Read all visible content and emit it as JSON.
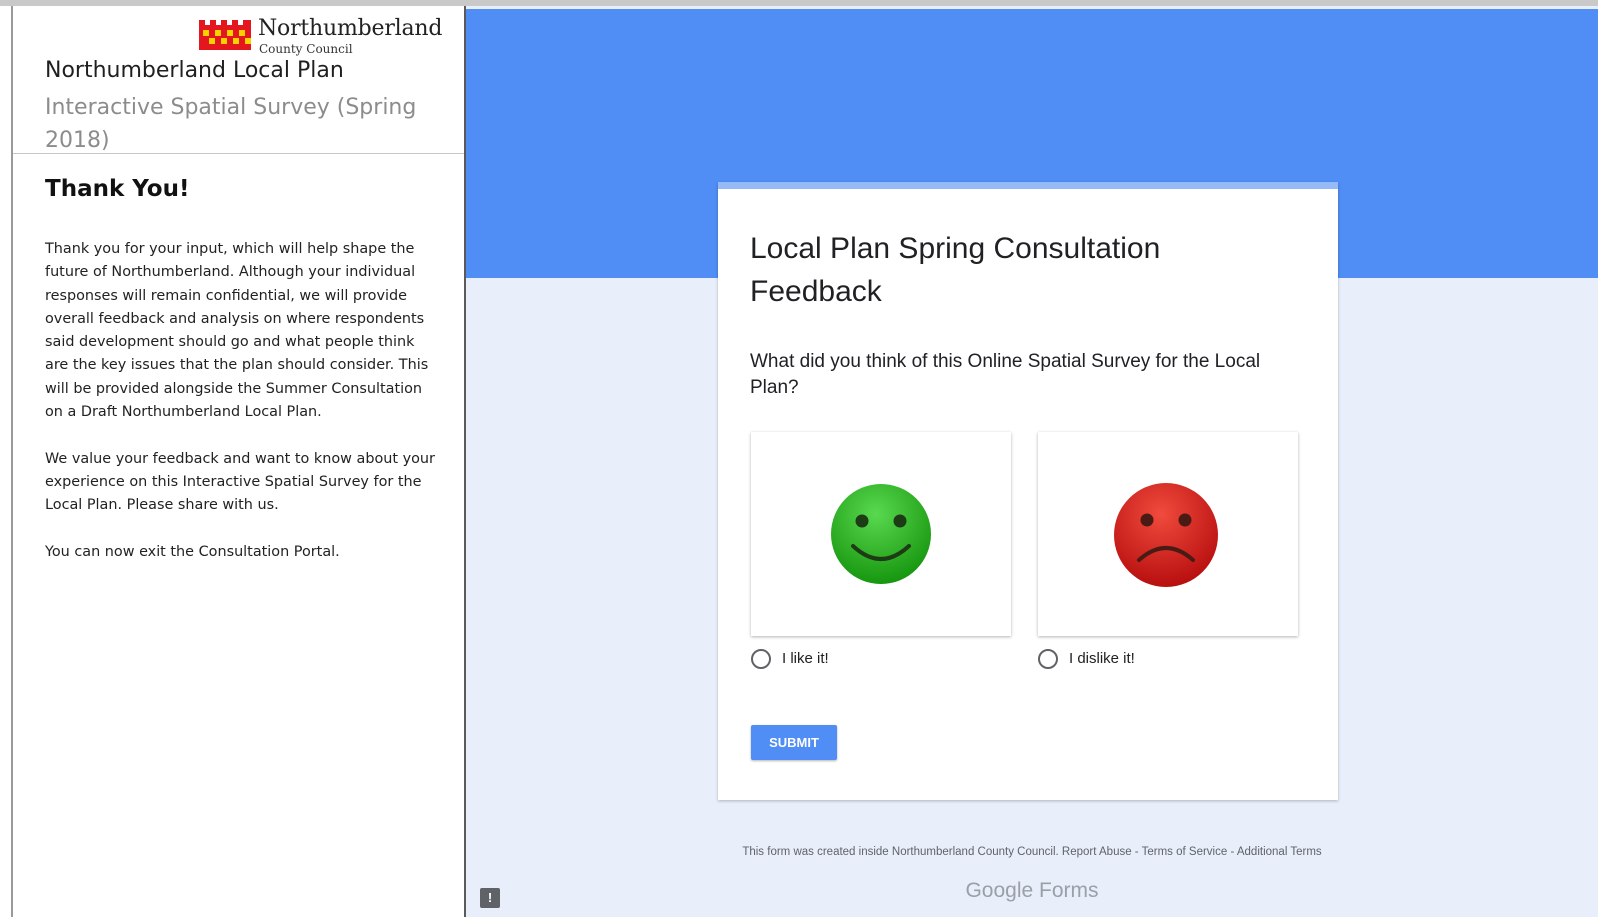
{
  "sidebar": {
    "logo": {
      "line1": "Northumberland",
      "line2": "County Council",
      "colors": [
        "#e4161e",
        "#f6d300"
      ]
    },
    "plan_title": "Northumberland Local Plan",
    "plan_subtitle": "Interactive Spatial Survey (Spring 2018)",
    "heading": "Thank You!",
    "paragraphs": [
      "Thank you for your input, which will help shape the future of Northumberland. Although your individual responses will remain confidential, we will provide overall feedback and analysis on where respondents said development should go and what people think are the key issues that the plan should consider. This will be provided alongside the Summer Consultation on a Draft Northumberland Local Plan.",
      "We value your feedback and want to know about your experience on this Interactive Spatial Survey for the Local Plan. Please share with us.",
      "You can now exit the Consultation Portal."
    ]
  },
  "form": {
    "title": "Local Plan Spring Consultation Feedback",
    "question": "What did you think of this Online Spatial Survey for the Local Plan?",
    "options": [
      {
        "label": "I like it!",
        "icon": "happy-face-icon",
        "color": "#2fb12a"
      },
      {
        "label": "I dislike it!",
        "icon": "sad-face-icon",
        "color": "#d81c1c"
      }
    ],
    "submit_label": "SUBMIT"
  },
  "footer": {
    "text": "This form was created inside Northumberland County Council.",
    "links": [
      "Report Abuse",
      "Terms of Service",
      "Additional Terms"
    ],
    "separator": " - ",
    "brand": "Google Forms",
    "report_icon": "!"
  },
  "colors": {
    "header_blue": "#508ef5",
    "background": "#e9eefb"
  }
}
